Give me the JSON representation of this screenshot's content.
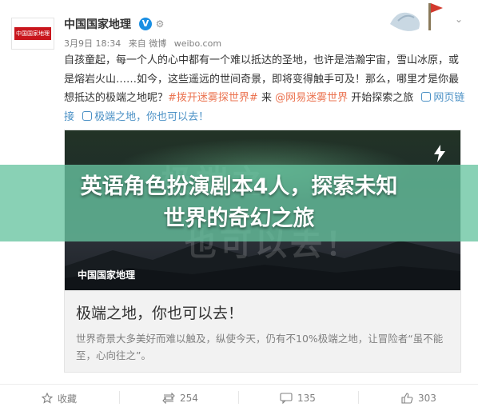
{
  "post": {
    "author": "中国国家地理",
    "avatar_text": "中国国家地理",
    "timestamp": "3月9日 18:34",
    "source_prefix": "来自",
    "source_name": "微博",
    "source_domain": "weibo.com",
    "text_main": "自孩童起，每一个人的心中都有一个难以抵达的圣地，也许是浩瀚宇宙，雪山冰原，或是熔岩火山……如今，这些遥远的世间奇景，即将变得触手可及！那么，哪里才是你最想抵达的极端之地呢？",
    "topic": "#拨开迷雾探世界#",
    "text_from": "来",
    "mention": "@网易迷雾世界",
    "text_end": "开始探索之旅",
    "link_label": "网页链接",
    "link_title": "极端之地，你也可以去！"
  },
  "card": {
    "image_bg_text_line1": "极端之",
    "image_bg_text_line2": "也可以去！",
    "source": "中国国家地理",
    "title": "极端之地，你也可以去！",
    "description": "世界奇景大多美好而难以触及，纵使今天，仍有不10%极端之地，让冒险者“虽不能至，心向往之”。"
  },
  "overlay": {
    "line1": "英语角色扮演剧本4人，探索未知",
    "line2": "世界的奇幻之旅"
  },
  "actions": {
    "favorite": "收藏",
    "repost": "254",
    "comment": "135",
    "like": "303"
  },
  "colors": {
    "accent_orange": "#eb7350",
    "link_blue": "#4a90c5",
    "verified_blue": "#1a8fe3",
    "overlay_green": "#68c4a0"
  }
}
